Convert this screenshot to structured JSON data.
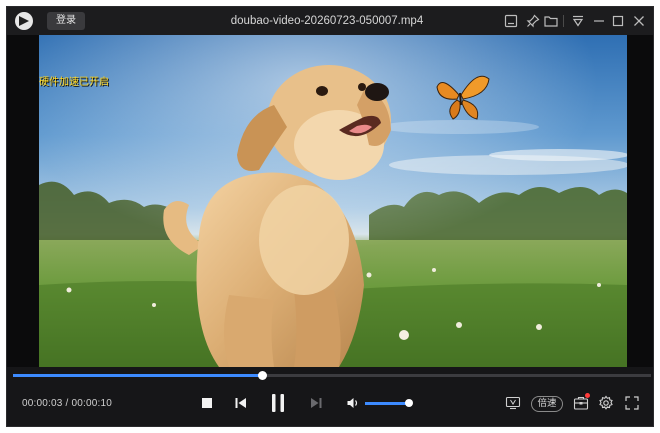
{
  "titlebar": {
    "login_label": "登录",
    "title": "doubao-video-20260723-050007.mp4",
    "icons": [
      "screenshot-icon",
      "pin-icon",
      "folder-icon",
      "collapse-icon",
      "minimize-icon",
      "maximize-icon",
      "close-icon"
    ]
  },
  "video": {
    "overlay_text": "硬件加速已开启"
  },
  "playback": {
    "progress": 0.39,
    "current_time": "00:00:03",
    "separator": "/",
    "total_time": "00:00:10",
    "volume": 0.95
  },
  "controls": {
    "speed_label": "倍速",
    "icons": [
      "stop-icon",
      "previous-icon",
      "pause-icon",
      "next-icon",
      "volume-icon",
      "tv-cast-icon",
      "toolbox-icon",
      "settings-icon",
      "fullscreen-icon"
    ]
  },
  "colors": {
    "accent": "#3d8bff",
    "background": "#161618",
    "overlay_text": "#ffd61f",
    "notification": "#ff3b3b"
  }
}
